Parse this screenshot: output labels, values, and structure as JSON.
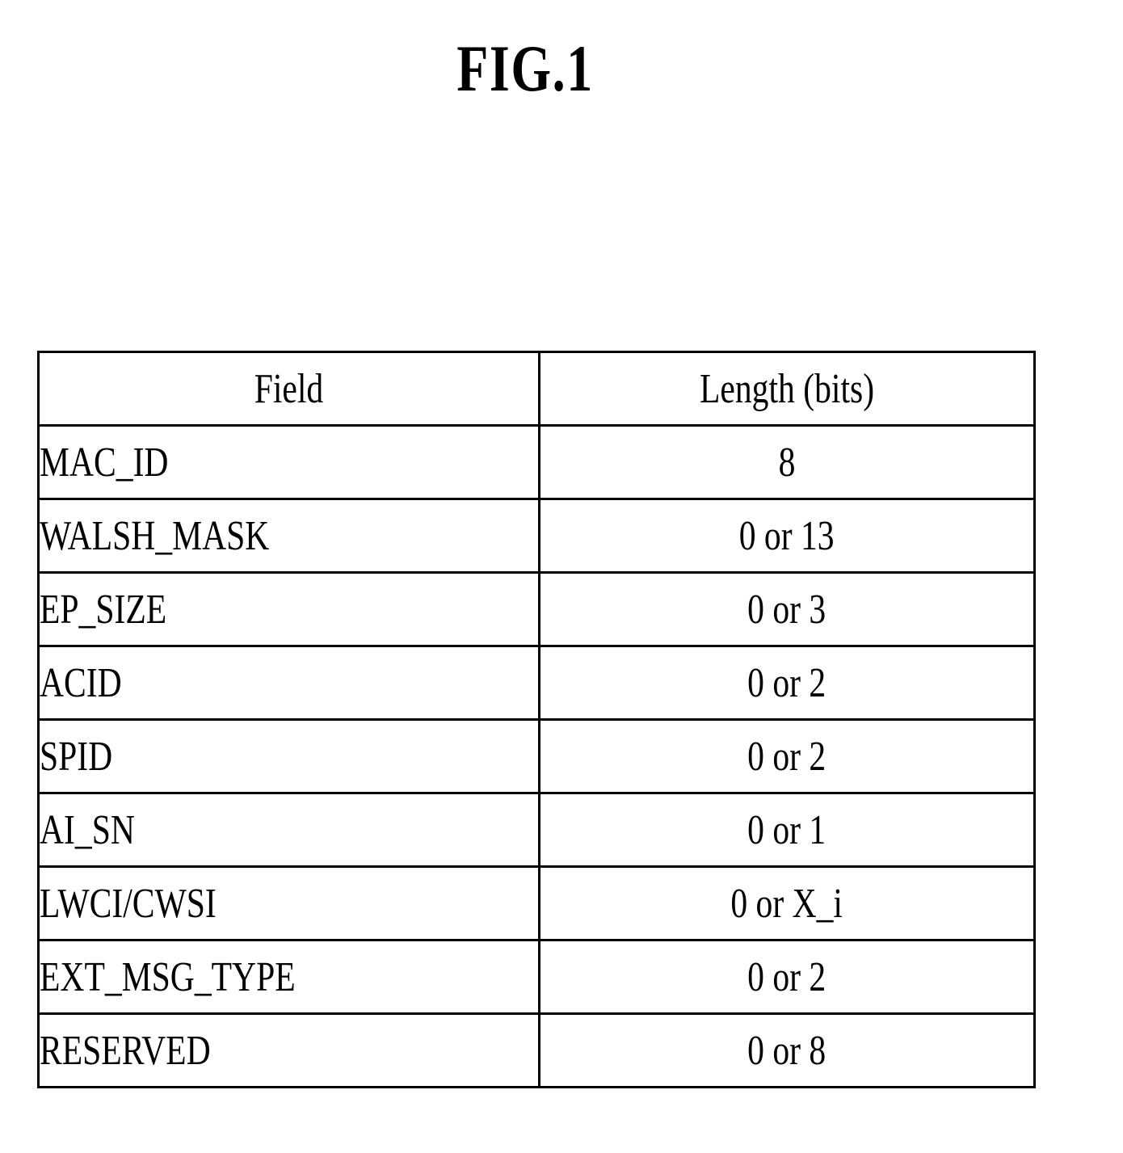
{
  "figure": {
    "title": "FIG.1"
  },
  "table": {
    "headers": {
      "field": "Field",
      "length": "Length (bits)"
    },
    "rows": [
      {
        "field": "MAC_ID",
        "length": "8"
      },
      {
        "field": "WALSH_MASK",
        "length": "0 or 13"
      },
      {
        "field": "EP_SIZE",
        "length": "0 or 3"
      },
      {
        "field": "ACID",
        "length": "0 or 2"
      },
      {
        "field": "SPID",
        "length": "0 or 2"
      },
      {
        "field": "AI_SN",
        "length": "0 or 1"
      },
      {
        "field": "LWCI/CWSI",
        "length": "0 or X_i"
      },
      {
        "field": "EXT_MSG_TYPE",
        "length": "0 or 2"
      },
      {
        "field": "RESERVED",
        "length": "0 or 8"
      }
    ]
  }
}
